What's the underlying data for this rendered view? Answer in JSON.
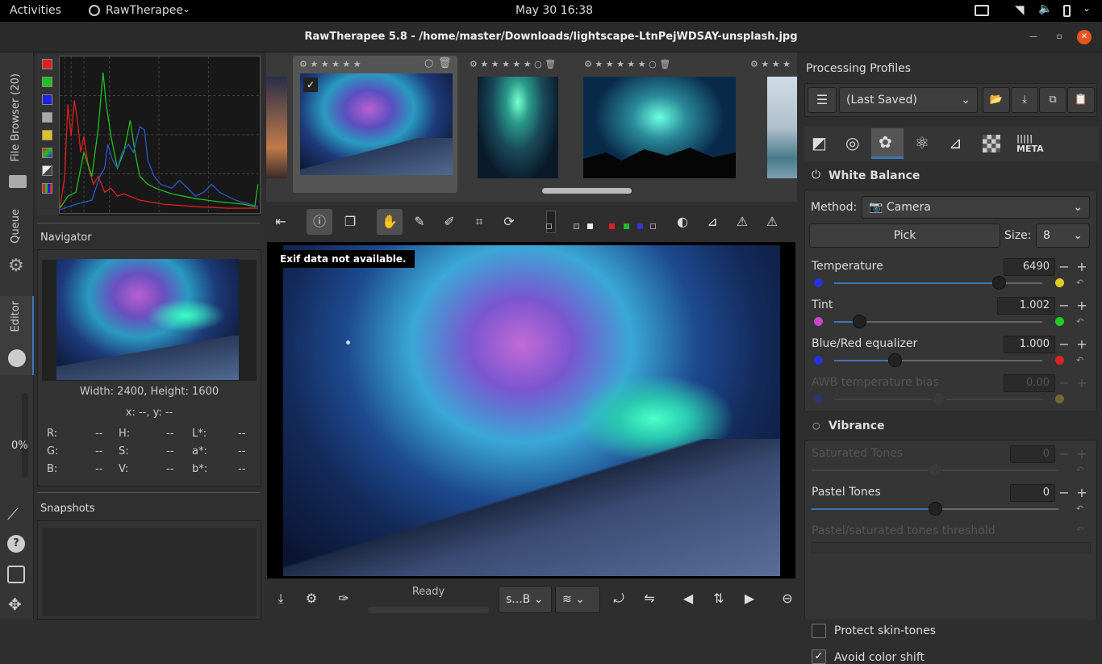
{
  "topbar": {
    "activities": "Activities",
    "app": "RawTherapee",
    "clock": "May 30  16:38"
  },
  "window": {
    "title": "RawTherapee 5.8 - /home/master/Downloads/lightscape-LtnPejWDSAY-unsplash.jpg"
  },
  "vtabs": {
    "file_browser": "File Browser (20)",
    "queue": "Queue",
    "editor": "Editor",
    "progress": "0%"
  },
  "navigator": {
    "title": "Navigator",
    "size": "Width: 2400, Height: 1600",
    "coords": "x: --, y: --",
    "rows": [
      {
        "a": "R:",
        "av": "--",
        "b": "H:",
        "bv": "--",
        "c": "L*:",
        "cv": "--"
      },
      {
        "a": "G:",
        "av": "--",
        "b": "S:",
        "bv": "--",
        "c": "a*:",
        "cv": "--"
      },
      {
        "a": "B:",
        "av": "--",
        "b": "V:",
        "bv": "--",
        "c": "b*:",
        "cv": "--"
      }
    ]
  },
  "snapshots": {
    "title": "Snapshots"
  },
  "viewer": {
    "exif": "Exif data not available."
  },
  "bottom": {
    "status": "Ready",
    "combo": "s...B"
  },
  "profiles": {
    "title": "Processing Profiles",
    "current": "(Last Saved)"
  },
  "wb": {
    "title": "White Balance",
    "method_label": "Method:",
    "method": "Camera",
    "pick": "Pick",
    "size_label": "Size:",
    "size": "8",
    "temperature": {
      "label": "Temperature",
      "value": "6490",
      "pos": 0.79
    },
    "tint": {
      "label": "Tint",
      "value": "1.002",
      "pos": 0.12
    },
    "bluered": {
      "label": "Blue/Red equalizer",
      "value": "1.000",
      "pos": 0.29
    },
    "awb": {
      "label": "AWB temperature bias",
      "value": "0.00",
      "pos": 0.5
    }
  },
  "vibrance": {
    "title": "Vibrance",
    "saturated": {
      "label": "Saturated Tones",
      "value": "0",
      "pos": 0.5
    },
    "pastel": {
      "label": "Pastel Tones",
      "value": "0",
      "pos": 0.5
    },
    "threshold": {
      "label": "Pastel/saturated tones threshold"
    },
    "protect": "Protect skin-tones",
    "avoid": "Avoid color shift"
  },
  "colors": {
    "accent": "#3d76b8",
    "close": "#e95420"
  }
}
